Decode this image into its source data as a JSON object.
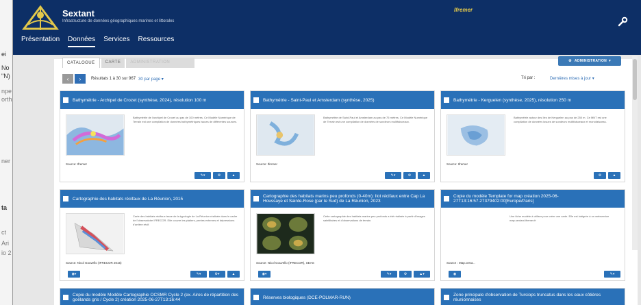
{
  "bg_window": {
    "fragments": [
      "ei",
      "No",
      "\"N)",
      "npe",
      "orth",
      "ner",
      "ta",
      "ct",
      "Ari",
      "io 2"
    ]
  },
  "header": {
    "brand": "Sextant",
    "tagline": "Infrastructure de données géographiques marines et littorales",
    "partner": "Ifremer",
    "nav": [
      "Présentation",
      "Données",
      "Services",
      "Ressources"
    ]
  },
  "tabs": [
    "CATALOGUE",
    "CARTE",
    "ADMINISTRATION"
  ],
  "admin_button": "ADMINISTRATION",
  "toolbar": {
    "results": "Résultats 1 à 30 sur 967",
    "per_page": "30 par page",
    "sort_label": "Tri par :",
    "sort_value": "Dernières mises à jour"
  },
  "cards": [
    {
      "title": "Bathymétrie - Archipel de Crozet (synthèse, 2024), résolution 100 m",
      "source": "Source: Ifremer",
      "abstract": "Bathymétrie de l'archipel de Crozet au pas de 100 mètres. Ce Modèle Numérique de Terrain est une compilation de données bathymétriques issues de différentes sources."
    },
    {
      "title": "Bathymétrie - Saint-Paul et Amsterdam (synthèse, 2025)",
      "source": "Source: Ifremer",
      "abstract": "Bathymétrie de Saint-Paul et Amsterdam au pas de 75 mètres. Ce Modèle Numérique de Terrain est une compilation de données de sondeurs multifaisceaux."
    },
    {
      "title": "Bathymétrie - Kerguelen (synthèse, 2025), résolution 250 m",
      "source": "Source: Ifremer",
      "abstract": "Bathymétrie autour des îles de Kerguelen au pas de 250 m. Ce MNT est une compilation de données issues de sondeurs multifaisceaux et monofaisceau."
    },
    {
      "title": "Cartographie des habitats récifaux de La Réunion, 2015",
      "source": "Source: Nicol Gouvello (IFRECOR 2015)",
      "abstract": "Carte des habitats récifaux issue de la typologie de La Réunion réalisée dans le cadre de l'observatoire IFRECOR. Elle couvre les platiers, pentes externes et dépressions d'arrière récif."
    },
    {
      "title": "Cartographie des habitats marins peu profonds (0-40m): Ilot récifaux entre Cap La Houssaye et Sainte-Rose (par le Sud) de La Réunion, 2023",
      "source": "Source: Nicol Gouvello (IFRECOR), SEAS",
      "abstract": "Cette cartographie des habitats marins peu profonds a été réalisée à partir d'images satellitaires et d'observations de terrain."
    },
    {
      "title": "Copie du modèle Template for map création 2025-06-27T13:16:57.27379402:00[Europe/Paris]",
      "source": "Source : Map.creat...",
      "abstract": "Une fiche modèle à utiliser pour créer une carte. Elle est intégrée à un webservice map.sextant.ifremer.fr"
    },
    {
      "title": "Copie du modèle Modèle Cartographie OCSMR Cycle 2 (ex. Aires de répartition des goélands gris / Cycle 2) création 2025-06-27T13:16:44",
      "source": "",
      "abstract": ""
    },
    {
      "title": "Réserves biologiques (DCE-POLMAR-RUN)",
      "source": "",
      "abstract": ""
    },
    {
      "title": "Zone principale d'observation de Tursiops truncatus dans les eaux côtières réunionnaises",
      "source": "",
      "abstract": ""
    }
  ],
  "colors": {
    "header_bg": "#0d2f66",
    "accent": "#2a71b8",
    "logo_gold": "#e2c84b"
  }
}
